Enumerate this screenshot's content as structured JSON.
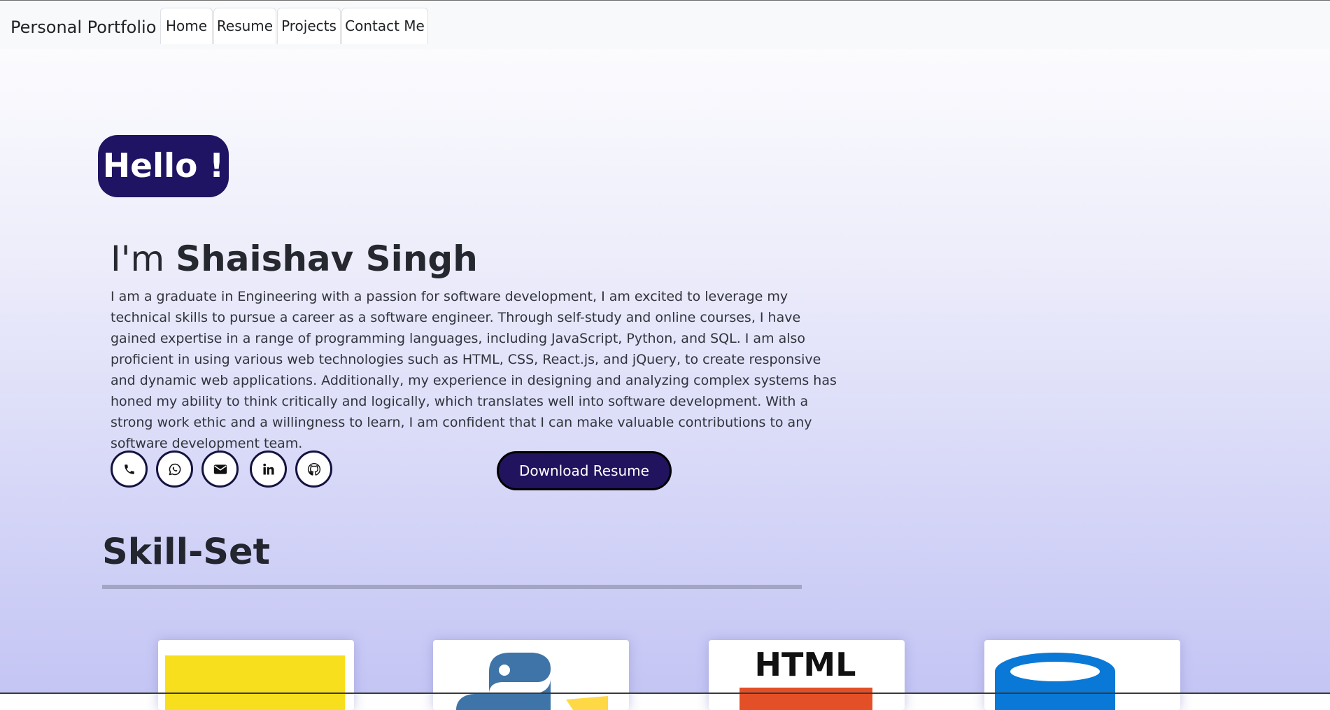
{
  "navbar": {
    "brand": "Personal Portfolio",
    "tabs": [
      {
        "label": "Home"
      },
      {
        "label": "Resume"
      },
      {
        "label": "Projects"
      },
      {
        "label": "Contact Me"
      }
    ]
  },
  "hero": {
    "greeting": "Hello !",
    "intro_prefix": "I'm ",
    "name": "Shaishav Singh",
    "bio": "I am a graduate in Engineering with a passion for software development, I am excited to leverage my technical skills to pursue a career as a software engineer. Through self-study and online courses, I have gained expertise in a range of programming languages, including JavaScript, Python, and SQL. I am also proficient in using various web technologies such as HTML, CSS, React.js, and jQuery, to create responsive and dynamic web applications. Additionally, my experience in designing and analyzing complex systems has honed my ability to think critically and logically, which translates well into software development. With a strong work ethic and a willingness to learn, I am confident that I can make valuable contributions to any software development team.",
    "social_icons": [
      "phone-icon",
      "whatsapp-icon",
      "email-icon",
      "linkedin-icon",
      "github-icon"
    ],
    "download_button": "Download Resume"
  },
  "skills": {
    "heading": "Skill-Set",
    "cards": [
      {
        "icon": "javascript-logo-icon"
      },
      {
        "icon": "python-logo-icon"
      },
      {
        "icon": "html-logo-icon",
        "logo_text": "HTML"
      },
      {
        "icon": "sql-database-icon"
      }
    ]
  },
  "colors": {
    "accent": "#1f1463",
    "button": "#21135d",
    "navbar_bg": "#f8f9fa",
    "bg_top": "#ffffff",
    "bg_bottom": "#c4c5f4"
  }
}
